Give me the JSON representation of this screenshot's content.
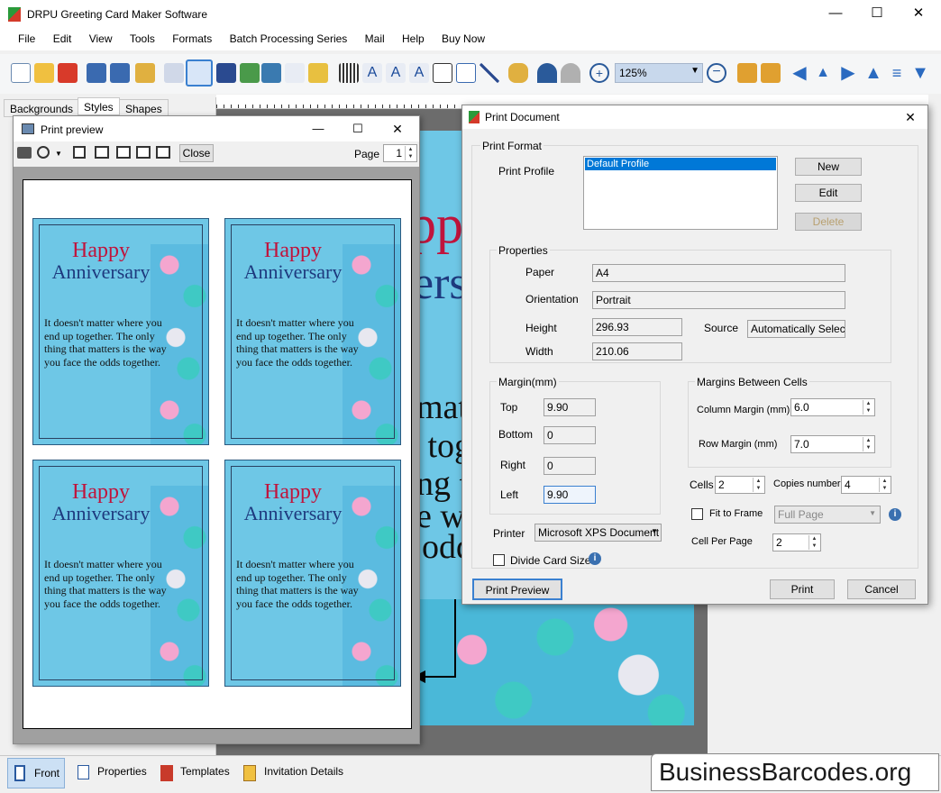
{
  "app": {
    "title": "DRPU Greeting Card Maker Software"
  },
  "menu": [
    "File",
    "Edit",
    "View",
    "Tools",
    "Formats",
    "Batch Processing Series",
    "Mail",
    "Help",
    "Buy Now"
  ],
  "toolbar": {
    "zoom": "125%"
  },
  "left_tabs": [
    "Backgrounds",
    "Styles",
    "Shapes"
  ],
  "card": {
    "line1": "ppy",
    "line2": "ers",
    "lines": [
      "matter",
      "u toge",
      "ng th",
      "e w",
      "odd"
    ]
  },
  "preview": {
    "title": "Print preview",
    "close_label": "Close",
    "page_label": "Page",
    "page_value": "1",
    "card": {
      "h1": "Happy",
      "h2": "Anniversary",
      "msg": "It doesn't matter where you end up together. The only thing that matters is the way you face the odds together."
    }
  },
  "print_dialog": {
    "title": "Print Document",
    "print_format": "Print Format",
    "print_profile_label": "Print Profile",
    "profiles": [
      "Default Profile"
    ],
    "new": "New",
    "edit": "Edit",
    "delete": "Delete",
    "properties": "Properties",
    "paper_label": "Paper",
    "paper": "A4",
    "orientation_label": "Orientation",
    "orientation": "Portrait",
    "height_label": "Height",
    "height": "296.93",
    "width_label": "Width",
    "width": "210.06",
    "source_label": "Source",
    "source": "Automatically Select",
    "margin_label": "Margin(mm)",
    "top_label": "Top",
    "top": "9.90",
    "bottom_label": "Bottom",
    "bottom": "0",
    "right_label": "Right",
    "right": "0",
    "left_label": "Left",
    "left": "9.90",
    "cells_margin_label": "Margins Between Cells",
    "column_margin_label": "Column Margin (mm)",
    "column_margin": "6.0",
    "row_margin_label": "Row Margin (mm)",
    "row_margin": "7.0",
    "cells_label": "Cells",
    "cells": "2",
    "copies_label": "Copies number",
    "copies": "4",
    "fit_label": "Fit to Frame",
    "fit_value": "Full Page",
    "cell_per_page_label": "Cell Per Page",
    "cell_per_page": "2",
    "printer_label": "Printer",
    "printer": "Microsoft XPS Document",
    "divide_label": "Divide Card Size",
    "print_preview": "Print Preview",
    "print": "Print",
    "cancel": "Cancel"
  },
  "statusbar": {
    "front": "Front",
    "properties": "Properties",
    "templates": "Templates",
    "invitation": "Invitation Details"
  },
  "brand": "BusinessBarcodes.org"
}
